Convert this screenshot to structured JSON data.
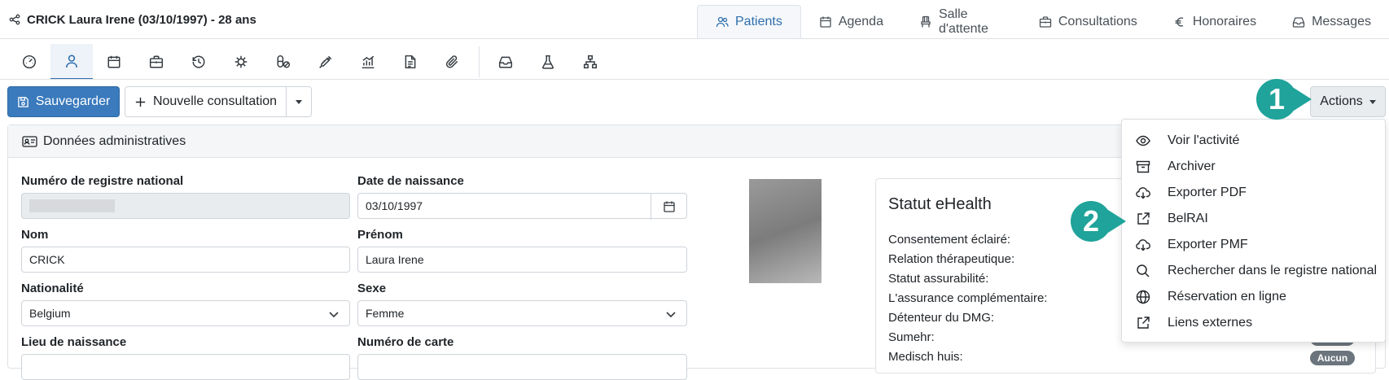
{
  "patient": {
    "title": "CRICK Laura Irene (03/10/1997) - 28 ans"
  },
  "main_tabs": [
    {
      "label": "Patients",
      "icon": "users-icon",
      "active": true
    },
    {
      "label": "Agenda",
      "icon": "calendar-icon"
    },
    {
      "label": "Salle d'attente",
      "icon": "chair-icon"
    },
    {
      "label": "Consultations",
      "icon": "briefcase-icon"
    },
    {
      "label": "Honoraires",
      "icon": "euro-icon"
    },
    {
      "label": "Messages",
      "icon": "inbox-icon"
    }
  ],
  "icon_toolbar": [
    "dashboard-icon",
    "patient-icon",
    "calendar-icon",
    "briefcase-icon",
    "history-icon",
    "virus-icon",
    "pills-icon",
    "syringe-icon",
    "chart-icon",
    "document-icon",
    "paperclip-icon",
    "inbox-icon",
    "flask-icon",
    "network-icon"
  ],
  "buttons": {
    "save": "Sauvegarder",
    "new_consultation": "Nouvelle consultation",
    "actions": "Actions"
  },
  "callouts": {
    "one": "1",
    "two": "2"
  },
  "card": {
    "title": "Données administratives"
  },
  "form": {
    "registre_label": "Numéro de registre national",
    "dob_label": "Date de naissance",
    "dob_value": "03/10/1997",
    "nom_label": "Nom",
    "nom_value": "CRICK",
    "prenom_label": "Prénom",
    "prenom_value": "Laura Irene",
    "nationalite_label": "Nationalité",
    "nationalite_value": "Belgium",
    "sexe_label": "Sexe",
    "sexe_value": "Femme",
    "lieu_label": "Lieu de naissance",
    "carte_label": "Numéro de carte"
  },
  "ehealth": {
    "title": "Statut eHealth",
    "rows": [
      "Consentement éclairé:",
      "Relation thérapeutique:",
      "Statut assurabilité:",
      "L'assurance complémentaire:",
      "Détenteur du DMG:",
      "Sumehr:",
      "Medisch huis:"
    ],
    "badge_medisch": "Aucun"
  },
  "actions_menu": [
    {
      "label": "Voir l'activité",
      "icon": "eye-icon"
    },
    {
      "label": "Archiver",
      "icon": "archive-icon"
    },
    {
      "label": "Exporter PDF",
      "icon": "cloud-download-icon"
    },
    {
      "label": "BelRAI",
      "icon": "external-link-icon"
    },
    {
      "label": "Exporter PMF",
      "icon": "cloud-download-icon"
    },
    {
      "label": "Rechercher dans le registre national",
      "icon": "search-icon"
    },
    {
      "label": "Réservation en ligne",
      "icon": "globe-icon"
    },
    {
      "label": "Liens externes",
      "icon": "external-link-icon"
    }
  ],
  "colors": {
    "primary": "#3a7abd",
    "callout": "#1fa39a",
    "badge": "#6c757d"
  }
}
